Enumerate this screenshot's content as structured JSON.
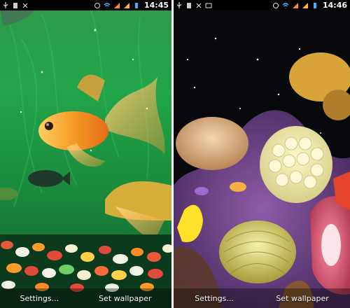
{
  "left_screen": {
    "status_time": "14:45",
    "settings_label": "Settings...",
    "wallpaper_label": "Set wallpaper"
  },
  "right_screen": {
    "status_time": "14:46",
    "settings_label": "Settings...",
    "wallpaper_label": "Set wallpaper"
  },
  "colors": {
    "status_bar": "#000000",
    "left_water": "#21a44a",
    "right_water": "#06080b",
    "wifi": "#3fb0ff",
    "signal": "#ff8a2a"
  }
}
